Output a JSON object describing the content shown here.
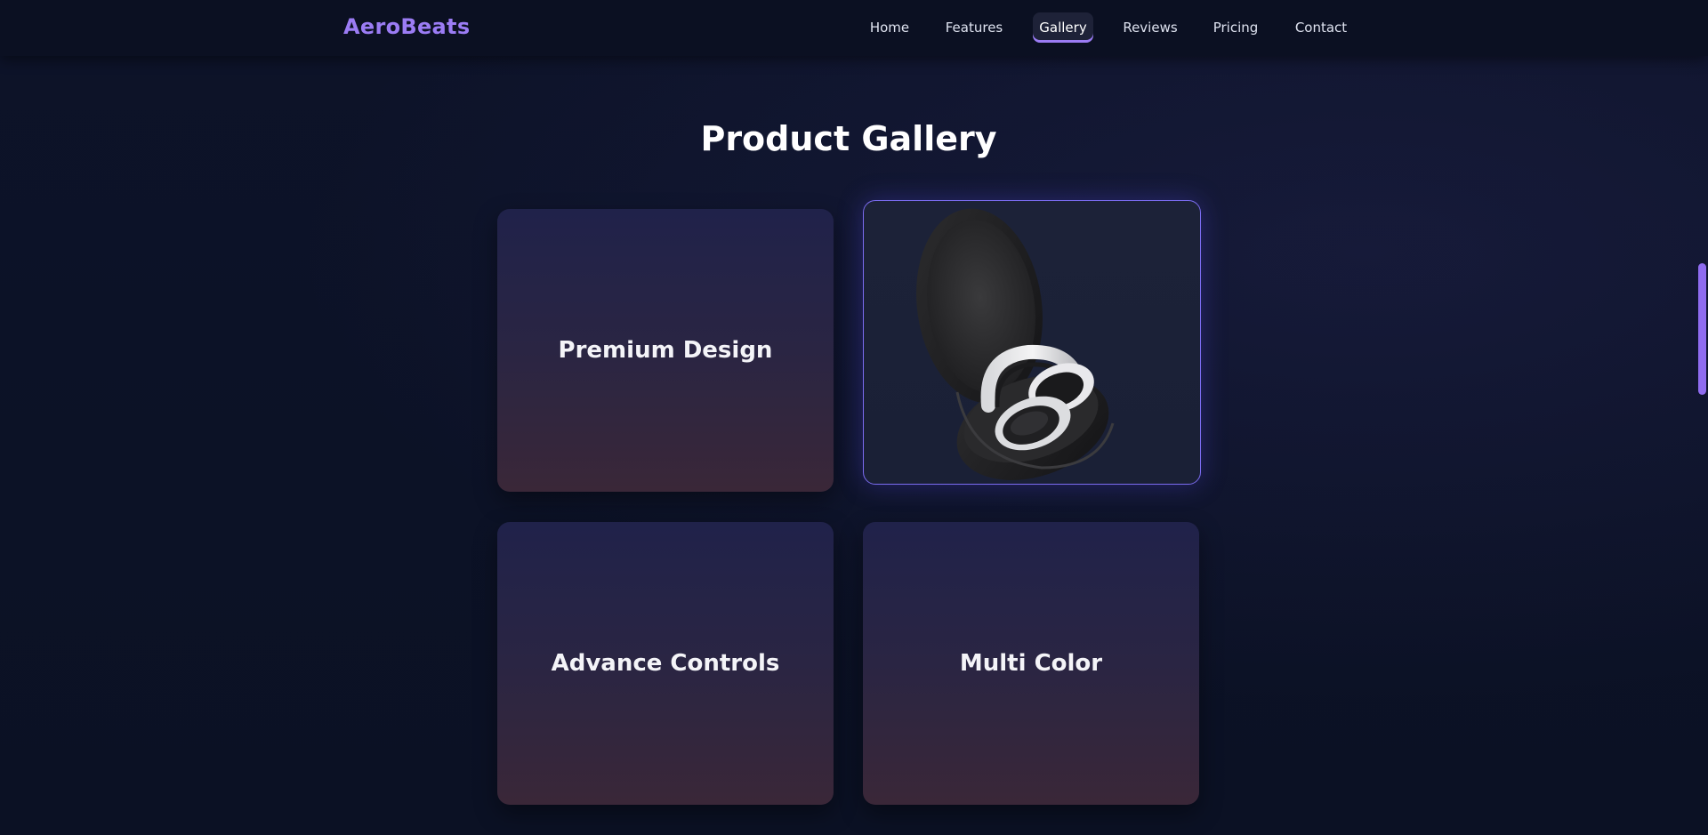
{
  "brand": {
    "name": "AeroBeats"
  },
  "nav": {
    "items": [
      {
        "label": "Home"
      },
      {
        "label": "Features"
      },
      {
        "label": "Gallery",
        "active": true
      },
      {
        "label": "Reviews"
      },
      {
        "label": "Pricing"
      },
      {
        "label": "Contact"
      }
    ]
  },
  "gallery": {
    "title": "Product Gallery",
    "cards": [
      {
        "label": "Premium Design"
      },
      {
        "image": "headphones-in-case-image"
      },
      {
        "label": "Advance Controls"
      },
      {
        "label": "Multi Color"
      }
    ]
  },
  "colors": {
    "accent": "#9b7cf4",
    "background": "#0c1226",
    "card_border": "#7b6cf0"
  }
}
